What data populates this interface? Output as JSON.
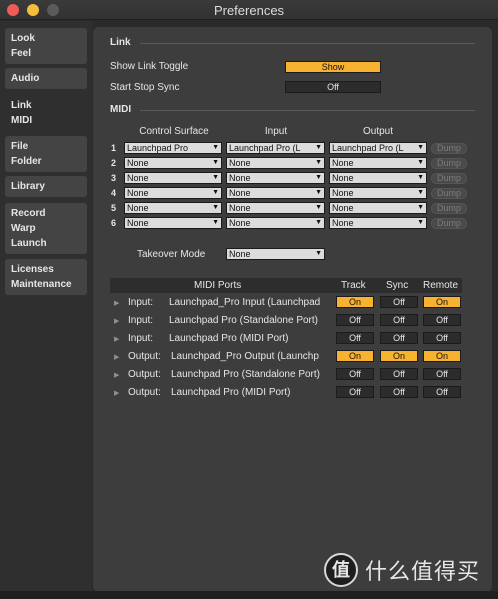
{
  "window": {
    "title": "Preferences"
  },
  "sidebar": {
    "items": [
      {
        "lines": [
          "Look",
          "Feel"
        ]
      },
      {
        "lines": [
          "Audio"
        ]
      },
      {
        "lines": [
          "Link",
          "MIDI"
        ]
      },
      {
        "lines": [
          "File",
          "Folder"
        ]
      },
      {
        "lines": [
          "Library"
        ]
      },
      {
        "lines": [
          "Record",
          "Warp",
          "Launch"
        ]
      },
      {
        "lines": [
          "Licenses",
          "Maintenance"
        ]
      }
    ],
    "active_index": 2
  },
  "link": {
    "section_title": "Link",
    "show_link_toggle_label": "Show Link Toggle",
    "show_link_toggle_value": "Show",
    "start_stop_sync_label": "Start Stop Sync",
    "start_stop_sync_value": "Off"
  },
  "midi": {
    "section_title": "MIDI",
    "col_control_surface": "Control Surface",
    "col_input": "Input",
    "col_output": "Output",
    "dump_label": "Dump",
    "rows": [
      {
        "num": "1",
        "surface": "Launchpad Pro",
        "input": "Launchpad Pro (L",
        "output": "Launchpad Pro (L"
      },
      {
        "num": "2",
        "surface": "None",
        "input": "None",
        "output": "None"
      },
      {
        "num": "3",
        "surface": "None",
        "input": "None",
        "output": "None"
      },
      {
        "num": "4",
        "surface": "None",
        "input": "None",
        "output": "None"
      },
      {
        "num": "5",
        "surface": "None",
        "input": "None",
        "output": "None"
      },
      {
        "num": "6",
        "surface": "None",
        "input": "None",
        "output": "None"
      }
    ],
    "takeover_mode_label": "Takeover Mode",
    "takeover_mode_value": "None"
  },
  "ports": {
    "header_midi_ports": "MIDI Ports",
    "header_track": "Track",
    "header_sync": "Sync",
    "header_remote": "Remote",
    "rows": [
      {
        "dir": "Input:",
        "name": "Launchpad_Pro Input (Launchpad",
        "track": "On",
        "sync": "Off",
        "remote": "On"
      },
      {
        "dir": "Input:",
        "name": "Launchpad Pro (Standalone Port)",
        "track": "Off",
        "sync": "Off",
        "remote": "Off"
      },
      {
        "dir": "Input:",
        "name": "Launchpad Pro (MIDI Port)",
        "track": "Off",
        "sync": "Off",
        "remote": "Off"
      },
      {
        "dir": "Output:",
        "name": "Launchpad_Pro Output (Launchp",
        "track": "On",
        "sync": "On",
        "remote": "On"
      },
      {
        "dir": "Output:",
        "name": "Launchpad Pro (Standalone Port)",
        "track": "Off",
        "sync": "Off",
        "remote": "Off"
      },
      {
        "dir": "Output:",
        "name": "Launchpad Pro (MIDI Port)",
        "track": "Off",
        "sync": "Off",
        "remote": "Off"
      }
    ]
  },
  "watermark": {
    "logo_glyph": "值",
    "text": "什么值得买"
  },
  "colors": {
    "accent_on": "#f7b232",
    "panel": "#3d3d3d",
    "sidebar": "#2f2f2f"
  }
}
